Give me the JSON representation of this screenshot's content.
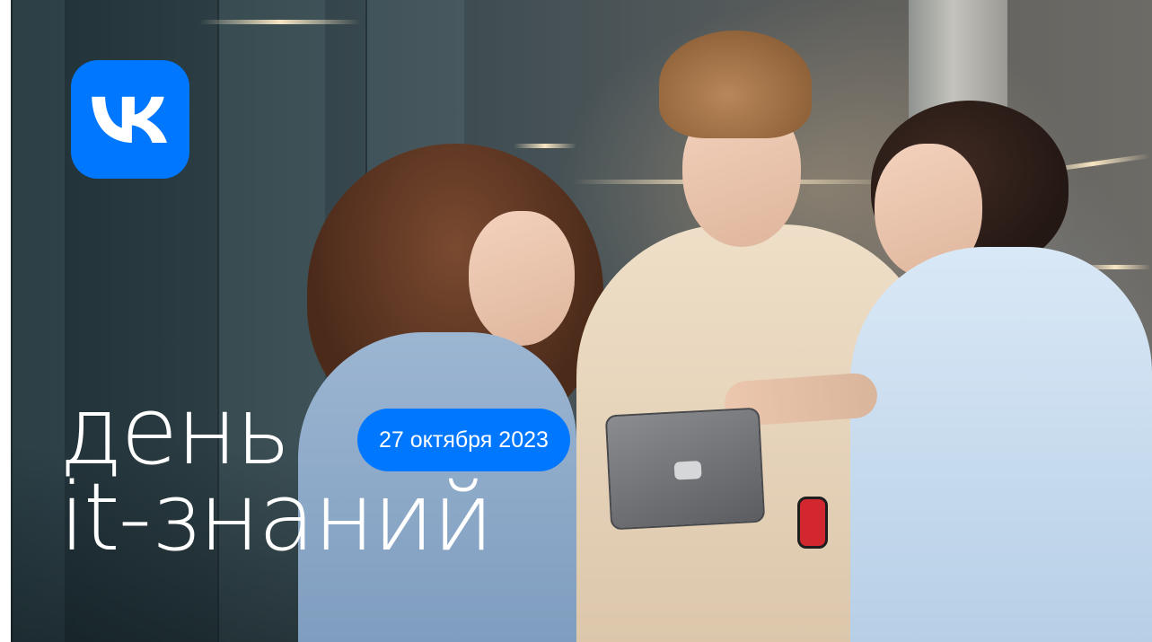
{
  "logo": {
    "icon": "vk-logo",
    "color": "#0077ff"
  },
  "headline": {
    "line1": "день",
    "line2": "it-знаний"
  },
  "date_badge": {
    "text": "27 октября 2023",
    "color": "#0077ff"
  }
}
